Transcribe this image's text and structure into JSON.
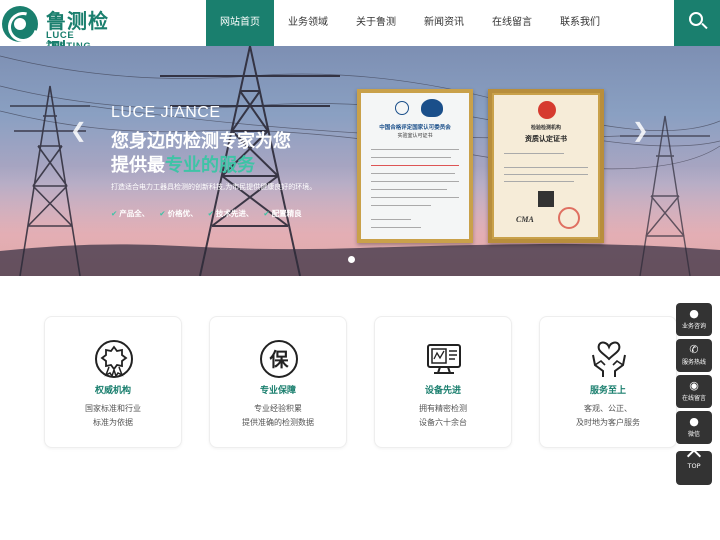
{
  "brand": {
    "name_cn": "鲁测检测",
    "name_en": "LUCE TESTING"
  },
  "nav": [
    {
      "label": "网站首页",
      "active": true
    },
    {
      "label": "业务领域",
      "active": false
    },
    {
      "label": "关于鲁测",
      "active": false
    },
    {
      "label": "新闻资讯",
      "active": false
    },
    {
      "label": "在线留言",
      "active": false
    },
    {
      "label": "联系我们",
      "active": false
    }
  ],
  "banner": {
    "en_title": "LUCE JIANCE",
    "headline_1": "您身边的检测专家为您",
    "headline_2_prefix": "提供最",
    "headline_2_highlight": "专业的服务",
    "description": "打造适合电力工器具检测的创新科技,为市民提供健康良好的环境。",
    "tags": [
      "产品全、",
      "价格优、",
      "技术先进、",
      "配置精良"
    ],
    "certificates": [
      {
        "org": "中国合格评定国家认可委员会",
        "title": "实验室认可证书",
        "logos": [
          "ilac-MRA",
          "CNAS"
        ]
      },
      {
        "org": "检验检测机构",
        "title": "资质认定证书",
        "mark": "CMA"
      }
    ]
  },
  "features": [
    {
      "icon": "medal-icon",
      "title": "权威机构",
      "lines": [
        "国家标准和行业",
        "标准为依据"
      ]
    },
    {
      "icon": "guarantee-icon",
      "glyph": "保",
      "title": "专业保障",
      "lines": [
        "专业经验积累",
        "提供准确的检测数据"
      ]
    },
    {
      "icon": "equipment-icon",
      "title": "设备先进",
      "lines": [
        "拥有精密检测",
        "设备六十余台"
      ]
    },
    {
      "icon": "service-hands-icon",
      "title": "服务至上",
      "lines": [
        "客观、公正、",
        "及时地为客户服务"
      ]
    }
  ],
  "sidebar": [
    {
      "icon": "qq-icon",
      "label": "业务咨询"
    },
    {
      "icon": "phone-icon",
      "label": "服务热线"
    },
    {
      "icon": "message-icon",
      "label": "在线留言"
    },
    {
      "icon": "wechat-icon",
      "label": "微信"
    }
  ],
  "back_to_top": "TOP",
  "colors": {
    "primary": "#1a7f6e",
    "accent": "#3fc3a6",
    "sidebar": "#333333"
  }
}
